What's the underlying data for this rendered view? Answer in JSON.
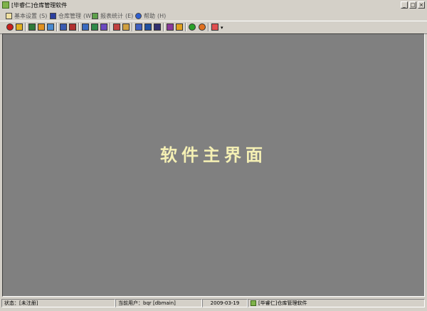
{
  "window": {
    "title": "[毕睿仁]仓库管理软件"
  },
  "menu": [
    {
      "label": "基本设置",
      "shortcut": "(S)",
      "icon": "settings-icon"
    },
    {
      "label": "仓库管理",
      "shortcut": "(W)",
      "icon": "warehouse-icon"
    },
    {
      "label": "报表统计",
      "shortcut": "(E)",
      "icon": "report-icon"
    },
    {
      "label": "帮助",
      "shortcut": "(H)",
      "icon": "help-icon"
    }
  ],
  "main": {
    "title": "软件主界面"
  },
  "status": {
    "state_label": "状态：",
    "state_value": "[未注册]",
    "user_label": "当前用户：",
    "user_value": "bqr [dbmain]",
    "date": "2009-03-19",
    "app_name": "[毕睿仁]仓库管理软件"
  },
  "colors": {
    "workspace": "#808080",
    "title_text": "#f5f0b4",
    "chrome": "#d4d0c8"
  }
}
